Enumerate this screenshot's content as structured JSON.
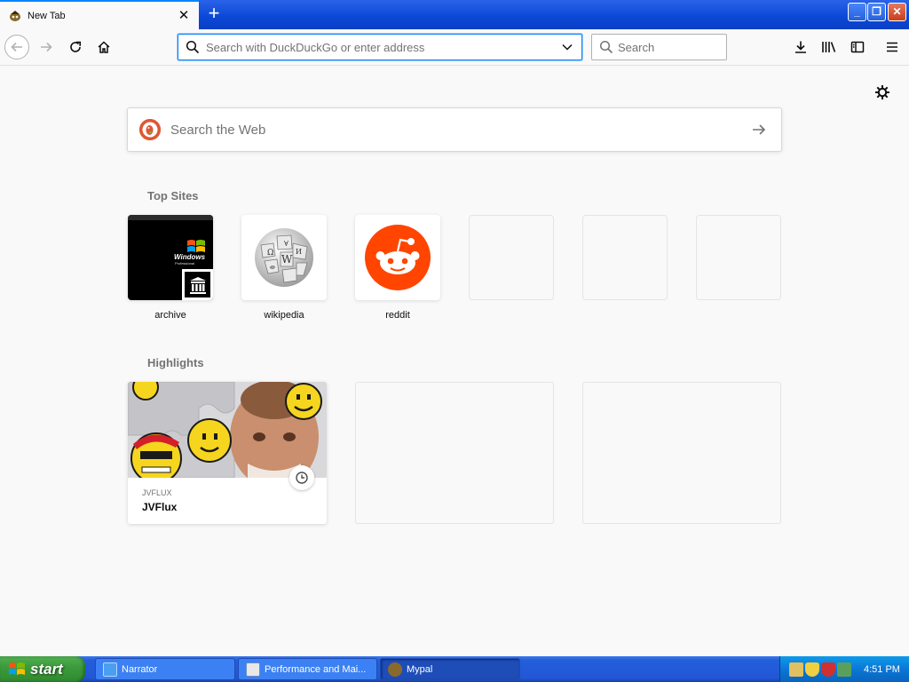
{
  "browser": {
    "tab": {
      "title": "New Tab",
      "close_glyph": "✕"
    },
    "new_tab_glyph": "+",
    "window_buttons": {
      "minimize": "_",
      "maximize": "❐",
      "close": "✕"
    },
    "url_bar": {
      "placeholder": "Search with DuckDuckGo or enter address",
      "value": ""
    },
    "search_bar": {
      "placeholder": "Search",
      "value": ""
    },
    "accent_color": "#0a84ff"
  },
  "newtab": {
    "web_search": {
      "placeholder": "Search the Web"
    },
    "top_sites": {
      "title": "Top Sites",
      "sites": [
        {
          "label": "archive"
        },
        {
          "label": "wikipedia"
        },
        {
          "label": "reddit"
        },
        {
          "label": ""
        },
        {
          "label": ""
        },
        {
          "label": ""
        }
      ]
    },
    "highlights": {
      "title": "Highlights",
      "items": [
        {
          "hostname": "JVFLUX",
          "title": "JVFlux"
        }
      ]
    },
    "archive_thumb_text": {
      "line1": "Windows",
      "line2": "Professional"
    }
  },
  "taskbar": {
    "start_label": "start",
    "tasks": [
      {
        "label": "Narrator",
        "icon": "narrator-icon"
      },
      {
        "label": "Performance and Mai...",
        "icon": "performance-icon"
      },
      {
        "label": "Mypal",
        "icon": "mypal-icon",
        "active": true
      }
    ],
    "clock": "4:51 PM"
  },
  "colors": {
    "reddit": "#ff4500",
    "duckduckgo": "#de5833",
    "xp_blue": "#245edb",
    "xp_green": "#3c9b3c"
  }
}
